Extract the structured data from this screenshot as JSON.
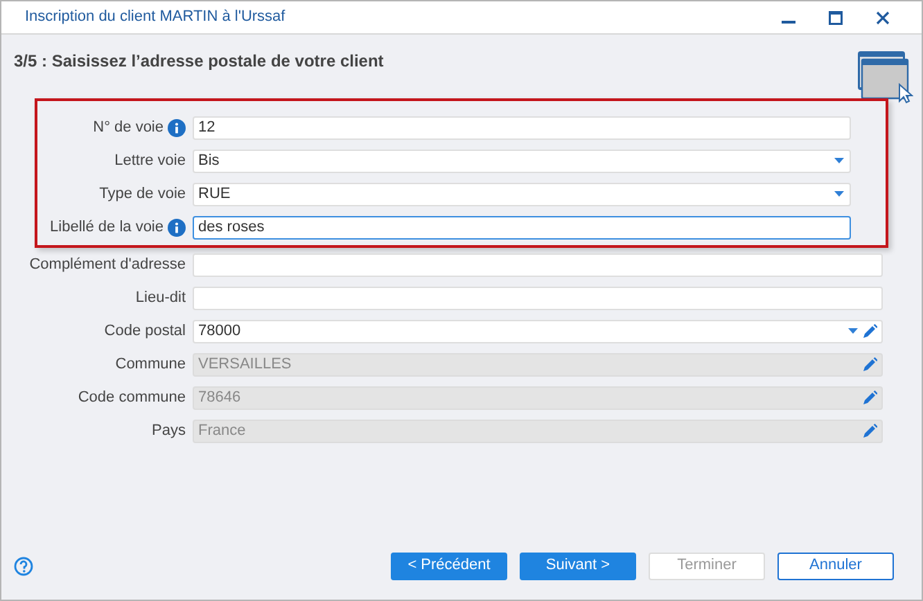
{
  "window": {
    "title": "Inscription du client MARTIN à l'Urssaf"
  },
  "step_title": "3/5 : Saisissez l’adresse postale de votre client",
  "highlighted_fields": [
    {
      "label": "N° de voie",
      "value": "12",
      "info": true,
      "disabled": false,
      "focused": false
    },
    {
      "label": "Lettre voie",
      "value": "Bis",
      "dropdown": true,
      "disabled": false,
      "focused": false
    },
    {
      "label": "Type de voie",
      "value": "RUE",
      "dropdown": true,
      "disabled": false,
      "focused": false
    },
    {
      "label": "Libellé de la voie",
      "value": "des roses",
      "info": true,
      "disabled": false,
      "focused": true
    }
  ],
  "fields": [
    {
      "label": "Complément d'adresse",
      "disabled": false,
      "focused": false
    },
    {
      "label": "Lieu-dit",
      "disabled": false,
      "focused": false
    },
    {
      "label": "Code postal",
      "value": "78000",
      "dropdown": true,
      "editable": true,
      "disabled": false,
      "focused": false
    },
    {
      "label": "Commune",
      "value": "VERSAILLES",
      "editable": true,
      "disabled": true,
      "focused": false
    },
    {
      "label": "Code commune",
      "value": "78646",
      "editable": true,
      "disabled": true,
      "focused": false
    },
    {
      "label": "Pays",
      "value": "France",
      "editable": true,
      "disabled": true,
      "focused": false
    }
  ],
  "buttons": [
    {
      "label": "< Précédent",
      "kind": "primary"
    },
    {
      "label": "Suivant >",
      "kind": "primary"
    },
    {
      "label": "Terminer",
      "kind": "disabled"
    },
    {
      "label": "Annuler",
      "kind": "focused"
    }
  ]
}
